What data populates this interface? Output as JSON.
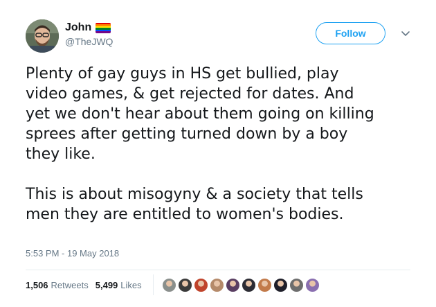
{
  "author": {
    "name": "John",
    "handle": "@TheJWQ",
    "flag_colors": [
      "#e40303",
      "#ff8c00",
      "#ffed00",
      "#008026",
      "#004dff",
      "#750787"
    ]
  },
  "actions": {
    "follow_label": "Follow",
    "menu_icon": "chevron-down-icon"
  },
  "tweet": {
    "text": "Plenty of gay guys in HS get bullied, play\nvideo games, & get rejected for dates. And\nyet we don't hear about them going on killing\nsprees after getting turned down by a boy\nthey like.\n\nThis is about misogyny & a society that tells\nmen they are entitled to women's bodies.",
    "timestamp": "5:53 PM - 19 May 2018"
  },
  "stats": {
    "retweets_count": "1,506",
    "retweets_label": "Retweets",
    "likes_count": "5,499",
    "likes_label": "Likes"
  },
  "likers": [
    {
      "color": "#8a8f8c"
    },
    {
      "color": "#3a3a3a"
    },
    {
      "color": "#c0442c"
    },
    {
      "color": "#b58a6a"
    },
    {
      "color": "#5a3e62"
    },
    {
      "color": "#2c2c34"
    },
    {
      "color": "#c27a4a"
    },
    {
      "color": "#1f1f2a"
    },
    {
      "color": "#6d6d6d"
    },
    {
      "color": "#8a6fb0"
    }
  ],
  "colors": {
    "accent": "#1da1f2",
    "secondary_text": "#657786",
    "divider": "#e6ecf0"
  }
}
